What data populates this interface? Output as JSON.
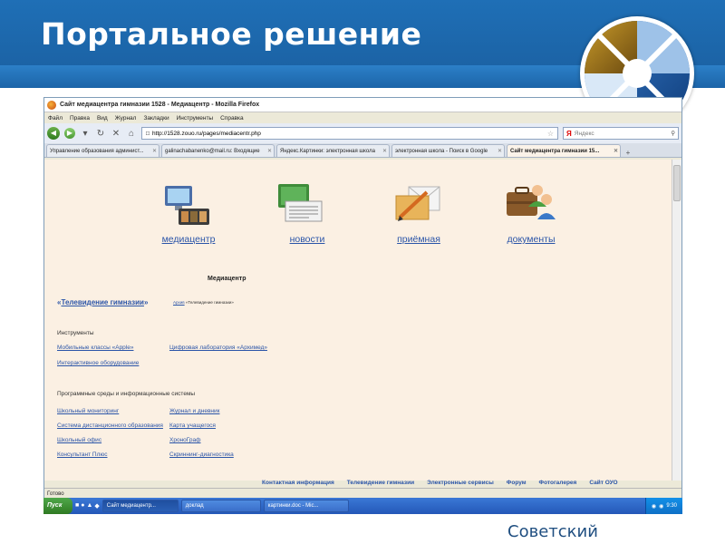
{
  "slide": {
    "title": "Портальное решение",
    "footer": "Советский"
  },
  "browser": {
    "window_title": "Сайт медиацентра гимназии 1528 - Медиацентр - Mozilla Firefox",
    "menu": [
      "Файл",
      "Правка",
      "Вид",
      "Журнал",
      "Закладки",
      "Инструменты",
      "Справка"
    ],
    "url": "http://1528.zouo.ru/pages/mediacentr.php",
    "search_placeholder": "Яндекс",
    "tabs": [
      {
        "label": "Управление образования админист...",
        "active": false
      },
      {
        "label": "galinachabanenko@mail.ru: Входящие",
        "active": false
      },
      {
        "label": "Яндекс.Картинки: электронная школа",
        "active": false
      },
      {
        "label": "электронная школа - Поиск в Google",
        "active": false
      },
      {
        "label": "Сайт медиацентра гимназии 15...",
        "active": true
      }
    ],
    "status": "Готово"
  },
  "page": {
    "nav": [
      {
        "label": "медиацентр",
        "icon": "computer-media-icon"
      },
      {
        "label": "новости",
        "icon": "newspaper-icon"
      },
      {
        "label": "приёмная",
        "icon": "envelope-pen-icon"
      },
      {
        "label": "документы",
        "icon": "briefcase-people-icon"
      }
    ],
    "section_title": "Медиацентр",
    "tv_prefix": "«",
    "tv_link": "Телевидение гимназии",
    "tv_suffix": "»",
    "tv_note_link": "Архив",
    "tv_note_text": "«Телевидение гимназии»",
    "tools_title": "Инструменты",
    "tools_col1": [
      "Мобильные классы «Apple»",
      "Интерактивное оборудование"
    ],
    "tools_col2": [
      "Цифровая лаборатория «Архимед»"
    ],
    "env_title": "Программные среды и информационные системы",
    "env_col1": [
      "Школьный мониторинг",
      "Система дистанционного образования",
      "Школьный офис",
      "Консультант Плюс"
    ],
    "env_col2": [
      "Журнал и дневник",
      "Карта учащегося",
      "ХроноГраф",
      "Скриннинг-диагностика"
    ],
    "bottom_links": [
      "Контактная информация",
      "Телевидение гимназии",
      "Электронные сервисы",
      "Форум",
      "Фотогалерея",
      "Сайт ОУО"
    ]
  },
  "taskbar": {
    "start": "Пуск",
    "tasks": [
      "Сайт медиацентр...",
      "доклад",
      "картинки.doc - Mic..."
    ],
    "time": "9:30"
  }
}
